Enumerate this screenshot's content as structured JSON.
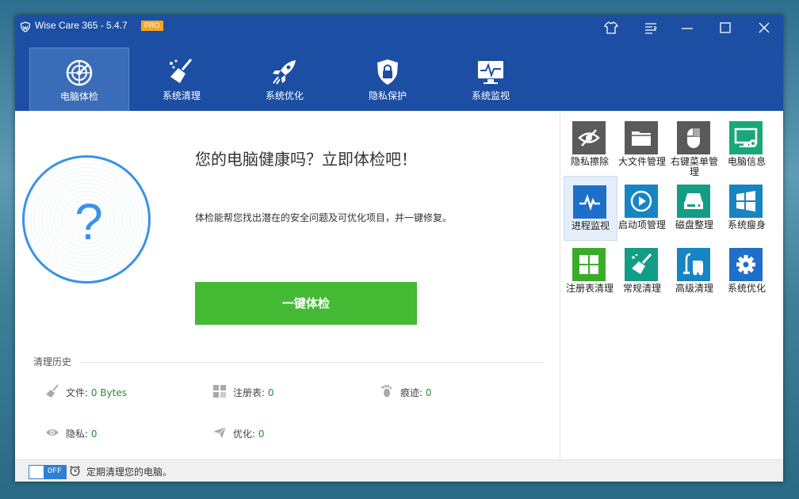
{
  "app": {
    "title": "Wise Care 365 - 5.4.7",
    "badge": "PRO"
  },
  "nav": [
    {
      "label": "电脑体检",
      "icon": "radar-icon",
      "active": true
    },
    {
      "label": "系统清理",
      "icon": "broom-icon"
    },
    {
      "label": "系统优化",
      "icon": "rocket-icon"
    },
    {
      "label": "隐私保护",
      "icon": "lock-shield-icon"
    },
    {
      "label": "系统监视",
      "icon": "monitor-pulse-icon"
    }
  ],
  "main": {
    "status_icon": "?",
    "headline": "您的电脑健康吗？立即体检吧！",
    "description": "体检能帮您找出潜在的安全问题及可优化项目，并一键修复。",
    "scan_button": "一键体检"
  },
  "history": {
    "title": "清理历史",
    "items": [
      {
        "label": "文件:",
        "value": "0 Bytes",
        "icon": "broom-icon"
      },
      {
        "label": "注册表:",
        "value": "0",
        "icon": "registry-icon"
      },
      {
        "label": "痕迹:",
        "value": "0",
        "icon": "footprint-icon"
      },
      {
        "label": "隐私:",
        "value": "0",
        "icon": "eye-icon"
      },
      {
        "label": "优化:",
        "value": "0",
        "icon": "paper-plane-icon"
      }
    ]
  },
  "tools": [
    {
      "label": "隐私擦除",
      "icon": "eye-slash-icon",
      "color": "#5a5a5a"
    },
    {
      "label": "大文件管理",
      "icon": "folder-icon",
      "color": "#5a5a5a"
    },
    {
      "label": "右键菜单管理",
      "icon": "mouse-icon",
      "color": "#5a5a5a"
    },
    {
      "label": "电脑信息",
      "icon": "computer-gear-icon",
      "color": "#1aa87a"
    },
    {
      "label": "进程监视",
      "icon": "pulse-icon",
      "color": "#1f6fc9",
      "active": true
    },
    {
      "label": "启动项管理",
      "icon": "play-icon",
      "color": "#1784c4"
    },
    {
      "label": "磁盘整理",
      "icon": "disk-icon",
      "color": "#139c86"
    },
    {
      "label": "系统瘦身",
      "icon": "windows-icon",
      "color": "#1784c4"
    },
    {
      "label": "注册表清理",
      "icon": "registry-grid-icon",
      "color": "#3aac2a"
    },
    {
      "label": "常规清理",
      "icon": "broom-icon",
      "color": "#139c86"
    },
    {
      "label": "高级清理",
      "icon": "vacuum-icon",
      "color": "#1784c4"
    },
    {
      "label": "系统优化",
      "icon": "gear-icon",
      "color": "#1f6fc9"
    }
  ],
  "bottom": {
    "toggle_state": "OFF",
    "schedule_text": "定期清理您的电脑。"
  }
}
